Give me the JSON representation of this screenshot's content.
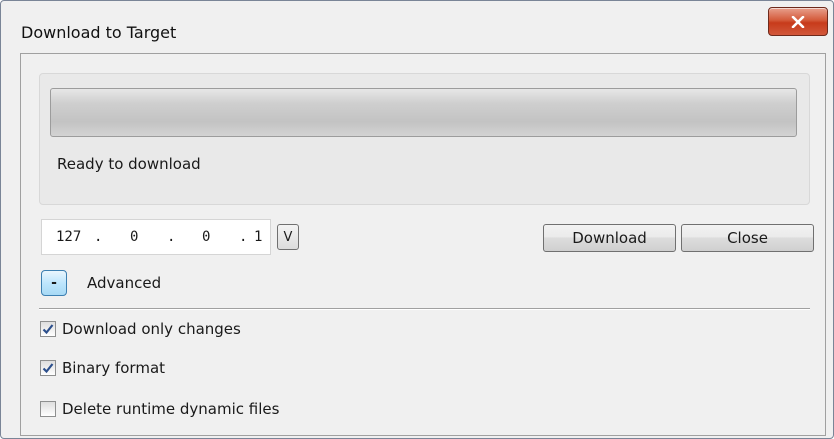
{
  "window": {
    "title": "Download to Target"
  },
  "status": {
    "text": "Ready to download",
    "progress": 0
  },
  "address": {
    "octets": [
      "127",
      "0",
      "0",
      "1"
    ],
    "separator": ".",
    "v_button_label": "V"
  },
  "buttons": {
    "download": "Download",
    "close": "Close"
  },
  "advanced": {
    "toggle_label": "-",
    "label": "Advanced"
  },
  "options": [
    {
      "label": "Download only changes",
      "checked": true
    },
    {
      "label": "Binary format",
      "checked": true
    },
    {
      "label": "Delete runtime dynamic files",
      "checked": false
    }
  ],
  "colors": {
    "accent": "#3c7fb1",
    "close_button": "#c73b1b",
    "check_mark": "#2c4f8c"
  }
}
